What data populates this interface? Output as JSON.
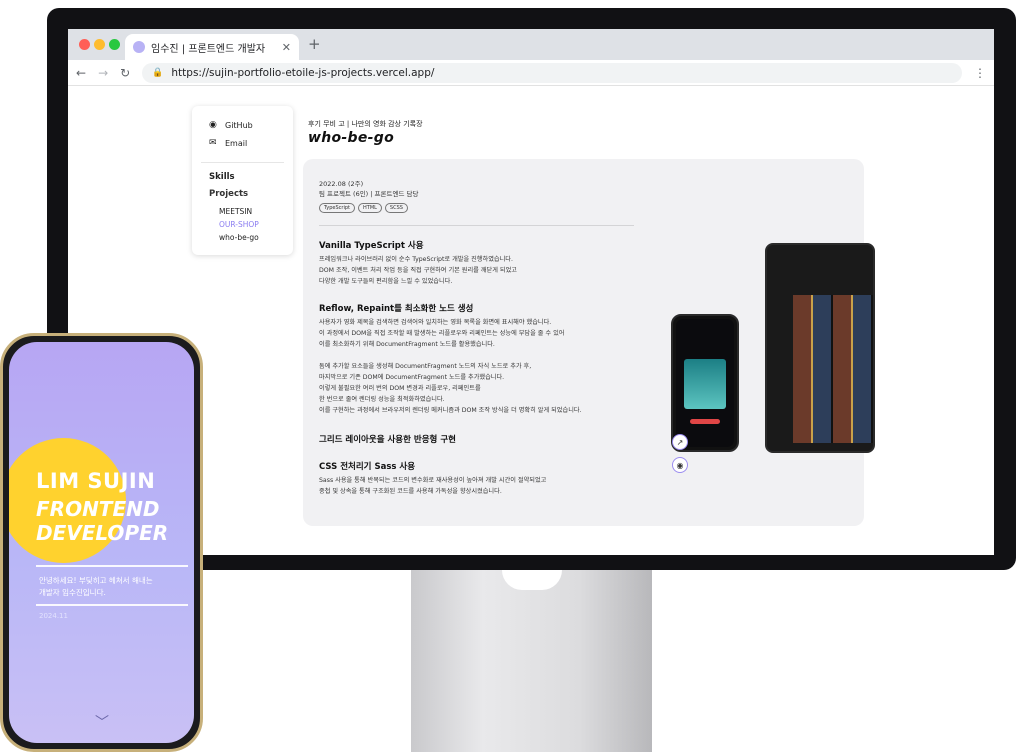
{
  "browser": {
    "tab_title": "임수진 | 프론트엔드 개발자",
    "url": "https://sujin-portfolio-etoile-js-projects.vercel.app/"
  },
  "sidebar": {
    "links": [
      {
        "label": "GitHub",
        "icon": "github-icon"
      },
      {
        "label": "Email",
        "icon": "mail-icon"
      }
    ],
    "skills": "Skills",
    "projects": "Projects",
    "project_items": [
      "MEETSIN",
      "OUR-SHOP",
      "who-be-go"
    ],
    "active_color": "#8a7cf0"
  },
  "project": {
    "subtitle": "후기 무비 고 | 나만의 영화 감상 기록장",
    "title": "who-be-go",
    "period": "2022.08 (2주)",
    "team": "팀 프로젝트 (6인) | 프론트엔드 담당",
    "chips": [
      "TypeScript",
      "HTML",
      "SCSS"
    ],
    "sections": [
      {
        "title": "Vanilla TypeScript 사용",
        "lines": [
          "프레임워크나 라이브러리 없이 순수 TypeScript로 개발을 진행하였습니다.",
          "DOM 조작, 이벤트 처리 작업 등을 직접 구현하여 기본 원리를 깨닫게 되었고",
          "다양한 개발 도구들의 편리함을 느낄 수 있었습니다."
        ]
      },
      {
        "title": "Reflow, Repaint를 최소화한 노드 생성",
        "lines": [
          "사용자가 영화 제목을 검색하면 검색어와 일치하는 영화 목록을 화면에 표시해야 했습니다.",
          "이 과정에서 DOM을 직접 조작할 때 발생하는 리플로우와 리페인트는 성능에 부담을 줄 수 있어",
          "이를 최소화하기 위해 DocumentFragment 노드를 활용했습니다.",
          "",
          "돔에 추가할 요소들을 생성해 DocumentFragment 노드의 자식 노드로 추가 후,",
          "마지막으로 기존 DOM에 DocumentFragment 노드를 추가했습니다.",
          "이렇게 불필요한 여러 번의 DOM 변경과 리플로우, 리페인트를",
          "한 번으로 줄여 렌더링 성능을 최적화하였습니다.",
          "이를 구현하는 과정에서 브라우저의 렌더링 메커니즘과 DOM 조작 방식을 더 명확히 알게 되었습니다."
        ]
      },
      {
        "title": "그리드 레이아웃을 사용한 반응형 구현",
        "lines": []
      },
      {
        "title": "CSS 전처리기 Sass 사용",
        "lines": [
          "Sass 사용을 통해 반복되는 코드의 변수화로 재사용성이 높아져 개발 시간이 절약되었고",
          "중첩 및 상속을 통해 구조화된 코드를 사용해 가독성을 향상시켰습니다."
        ]
      }
    ],
    "buttons": [
      {
        "icon": "external-link-icon"
      },
      {
        "icon": "github-icon"
      }
    ]
  },
  "mobile": {
    "hero_name": "LIM SUJIN",
    "hero_role_1": "FRONTEND",
    "hero_role_2": "DEVELOPER",
    "intro_1": "안녕하세요! 부딪히고 헤쳐서 해내는",
    "intro_2": "개발자 임수진입니다.",
    "date": "2024.11",
    "accent": "#ffd22e"
  }
}
